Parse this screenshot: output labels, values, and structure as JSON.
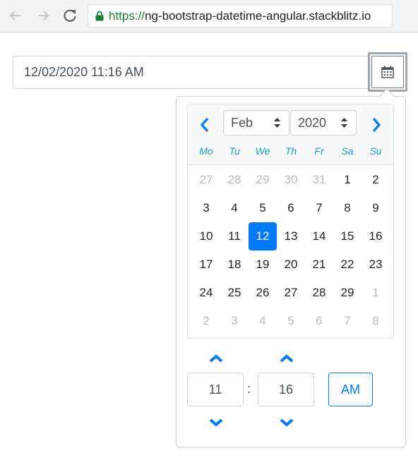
{
  "browser": {
    "url_scheme": "https://",
    "url_host": "ng-bootstrap-datetime-angular.stackblitz.io",
    "colors": {
      "secure": "#188038",
      "toolbar": "#f1f3f4"
    },
    "icons": [
      "back-arrow-icon",
      "forward-arrow-icon",
      "reload-icon",
      "lock-icon"
    ]
  },
  "datetime_input": {
    "value": "12/02/2020 11:16 AM",
    "toggle_icon": "calendar-icon"
  },
  "calendar": {
    "month": "Feb",
    "year": "2020",
    "prev_icon": "chevron-left-icon",
    "next_icon": "chevron-right-icon",
    "weekdays": [
      "Mo",
      "Tu",
      "We",
      "Th",
      "Fr",
      "Sa",
      "Su"
    ],
    "weeks": [
      [
        {
          "d": "27",
          "m": true
        },
        {
          "d": "28",
          "m": true
        },
        {
          "d": "29",
          "m": true
        },
        {
          "d": "30",
          "m": true
        },
        {
          "d": "31",
          "m": true
        },
        {
          "d": "1"
        },
        {
          "d": "2"
        }
      ],
      [
        {
          "d": "3"
        },
        {
          "d": "4"
        },
        {
          "d": "5"
        },
        {
          "d": "6"
        },
        {
          "d": "7"
        },
        {
          "d": "8"
        },
        {
          "d": "9"
        }
      ],
      [
        {
          "d": "10"
        },
        {
          "d": "11"
        },
        {
          "d": "12",
          "s": true
        },
        {
          "d": "13"
        },
        {
          "d": "14"
        },
        {
          "d": "15"
        },
        {
          "d": "16"
        }
      ],
      [
        {
          "d": "17"
        },
        {
          "d": "18"
        },
        {
          "d": "19"
        },
        {
          "d": "20"
        },
        {
          "d": "21"
        },
        {
          "d": "22"
        },
        {
          "d": "23"
        }
      ],
      [
        {
          "d": "24"
        },
        {
          "d": "25"
        },
        {
          "d": "26"
        },
        {
          "d": "27"
        },
        {
          "d": "28"
        },
        {
          "d": "29"
        },
        {
          "d": "1",
          "m": true
        }
      ],
      [
        {
          "d": "2",
          "m": true
        },
        {
          "d": "3",
          "m": true
        },
        {
          "d": "4",
          "m": true
        },
        {
          "d": "5",
          "m": true
        },
        {
          "d": "6",
          "m": true
        },
        {
          "d": "7",
          "m": true
        },
        {
          "d": "8",
          "m": true
        }
      ]
    ],
    "colors": {
      "accent": "#007bff",
      "weekday": "#17a2b8",
      "muted": "#b8bcc0"
    }
  },
  "time": {
    "hour": "11",
    "minute": "16",
    "separator": ":",
    "meridian": "AM",
    "increment_icon": "chevron-up-icon",
    "decrement_icon": "chevron-down-icon"
  }
}
